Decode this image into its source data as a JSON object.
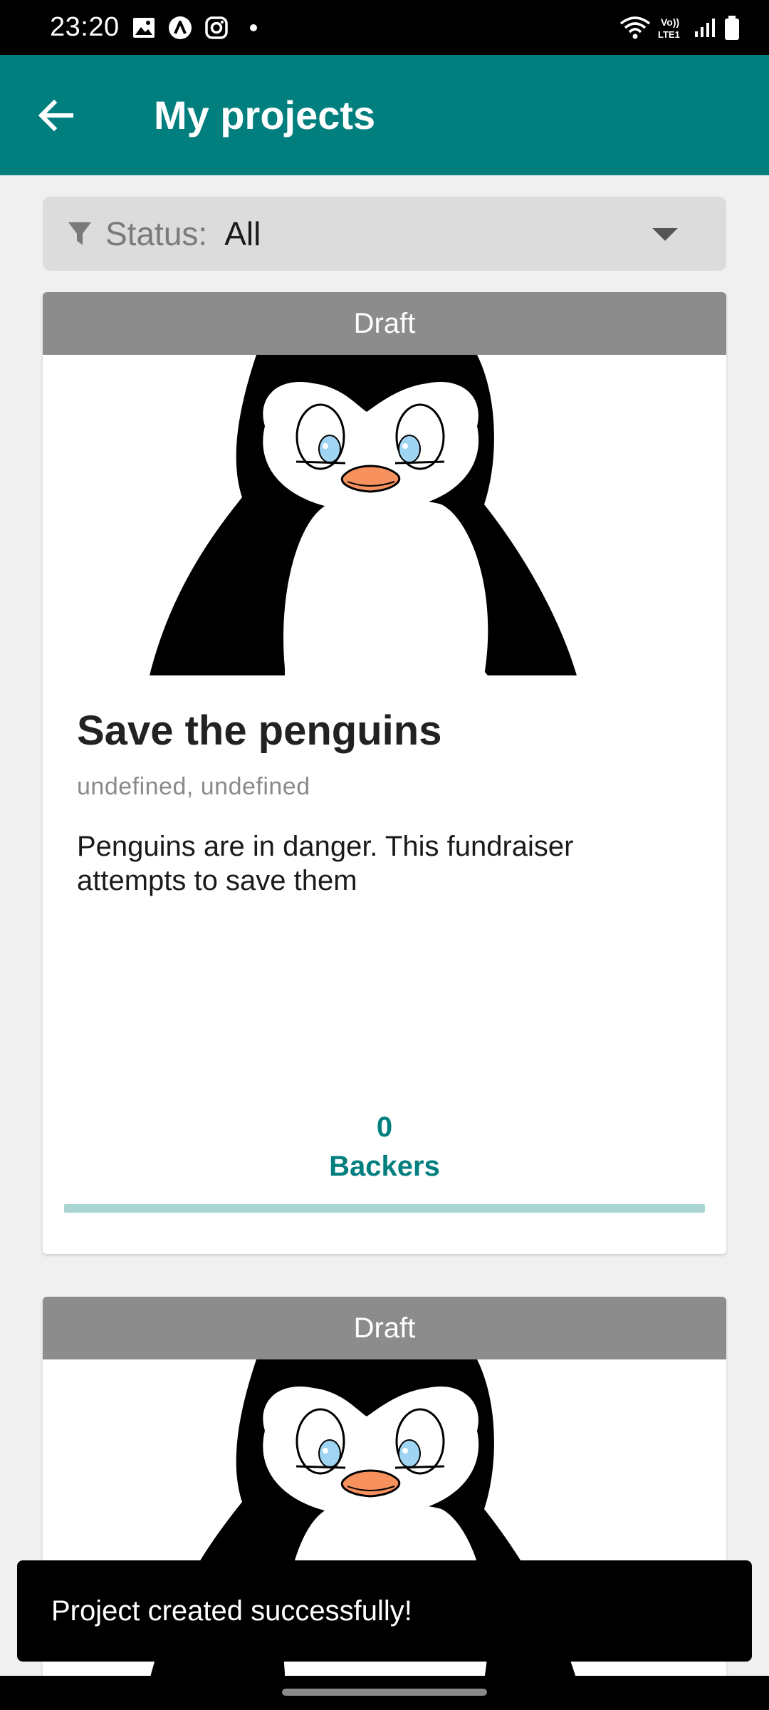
{
  "status_bar": {
    "time": "23:20",
    "left_icons": [
      "gallery-icon",
      "app-a-icon",
      "instagram-icon",
      "dot-icon"
    ],
    "right_icons": [
      "wifi-icon",
      "volte-icon",
      "signal-icon",
      "battery-icon"
    ],
    "volte_label": "Vo)) LTE1"
  },
  "app_bar": {
    "back_icon": "arrow-left-icon",
    "title": "My projects",
    "color": "#017e7e"
  },
  "filter": {
    "icon": "filter-icon",
    "label": "Status:",
    "value": "All"
  },
  "projects": [
    {
      "status": "Draft",
      "image": "penguin-illustration",
      "title": "Save the penguins",
      "subtitle": "undefined, undefined",
      "description": "Penguins are in danger. This fundraiser attempts to save them",
      "backers_count": "0",
      "backers_label": "Backers",
      "progress": 0
    },
    {
      "status": "Draft",
      "image": "penguin-illustration"
    }
  ],
  "snackbar": {
    "message": "Project created successfully!"
  }
}
